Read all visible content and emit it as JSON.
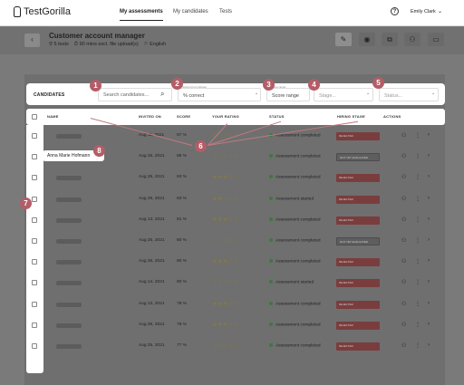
{
  "app": {
    "logo_mark": "",
    "logo_a": "Test",
    "logo_b": "Gorilla"
  },
  "nav": {
    "assessments": "My assessments",
    "candidates": "My candidates",
    "tests": "Tests"
  },
  "help_icon": "?",
  "user": {
    "name": "Emily Clark",
    "caret": "⌄"
  },
  "header": {
    "back": "‹",
    "title": "Customer account manager",
    "meta": [
      "⚲ 5 tests",
      "⏱ 90 mins excl. file upload(s)",
      "⚐ English"
    ],
    "tools": [
      "✎",
      "◉",
      "⧉",
      "⚇",
      "▭"
    ]
  },
  "filters": {
    "label": "CANDIDATES",
    "search_placeholder": "Search candidates...",
    "search_icon": "⌕",
    "sort_small": "Sorting from highest",
    "sort": "% correct",
    "score_small": "Score range",
    "score": "Score range",
    "stage": "Stage...",
    "status": "Status...",
    "caret": "⌄"
  },
  "columns": [
    "NAME",
    "INVITED ON",
    "SCORE",
    "YOUR RATING",
    "STATUS",
    "HIRING STAGE",
    "ACTIONS"
  ],
  "popup_name": "Anna Marie Hofmann",
  "rows": [
    {
      "date": "Aug 11, 2021",
      "score": "87 %",
      "stars": "☆☆☆☆☆",
      "status": "Assessment completed",
      "stage": "REJECTED",
      "alt": false
    },
    {
      "date": "Aug 25, 2021",
      "score": "86 %",
      "stars": "☆☆☆☆☆",
      "status": "Assessment completed",
      "stage": "NOT YET EVALUATED",
      "alt": true
    },
    {
      "date": "Aug 25, 2021",
      "score": "83 %",
      "stars": "★★★☆☆",
      "status": "Assessment completed",
      "stage": "REJECTED",
      "alt": false
    },
    {
      "date": "Aug 25, 2021",
      "score": "83 %",
      "stars": "★★☆☆☆",
      "status": "Assessment started",
      "stage": "REJECTED",
      "alt": false
    },
    {
      "date": "Aug 13, 2021",
      "score": "81 %",
      "stars": "★★★☆☆",
      "status": "Assessment completed",
      "stage": "REJECTED",
      "alt": false
    },
    {
      "date": "Aug 25, 2021",
      "score": "80 %",
      "stars": "☆☆☆☆☆",
      "status": "Assessment completed",
      "stage": "NOT YET EVALUATED",
      "alt": true
    },
    {
      "date": "Aug 25, 2021",
      "score": "80 %",
      "stars": "★★★☆☆",
      "status": "Assessment completed",
      "stage": "REJECTED",
      "alt": false
    },
    {
      "date": "Aug 14, 2021",
      "score": "80 %",
      "stars": "☆☆☆☆☆",
      "status": "Assessment started",
      "stage": "REJECTED",
      "alt": false
    },
    {
      "date": "Aug 13, 2021",
      "score": "78 %",
      "stars": "★★★☆☆",
      "status": "Assessment completed",
      "stage": "REJECTED",
      "alt": false
    },
    {
      "date": "Aug 25, 2021",
      "score": "78 %",
      "stars": "★★★☆☆",
      "status": "Assessment completed",
      "stage": "REJECTED",
      "alt": false
    },
    {
      "date": "Aug 25, 2021",
      "score": "77 %",
      "stars": "☆☆☆☆☆",
      "status": "Assessment completed",
      "stage": "REJECTED",
      "alt": false
    }
  ],
  "row_icons": {
    "person": "⚇",
    "more": "⋮",
    "chevron": "›"
  },
  "callouts": [
    "1",
    "2",
    "3",
    "4",
    "5",
    "6",
    "7",
    "8"
  ],
  "colors": {
    "callout": "#b35d67",
    "stage_rejected": "#7a3d3d",
    "status_dot": "#3a7a3a"
  }
}
